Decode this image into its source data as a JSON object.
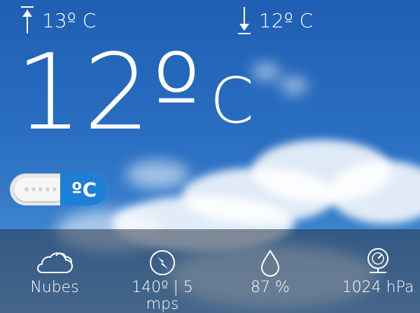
{
  "max_temp": "13º C",
  "min_temp": "12º C",
  "current_temp": "12º",
  "unit": "C",
  "toggle": {
    "label": "ºC",
    "state": "on"
  },
  "stats": [
    {
      "icon": "cloud-icon",
      "label": "Nubes"
    },
    {
      "icon": "compass-icon",
      "label": "140º | 5 mps"
    },
    {
      "icon": "drop-icon",
      "label": "87 %"
    },
    {
      "icon": "barometer-icon",
      "label": "1024 hPa"
    }
  ],
  "colors": {
    "sky": "#2a6fc2",
    "toggle_on": "#1d7fd6",
    "bar": "#28374b"
  }
}
